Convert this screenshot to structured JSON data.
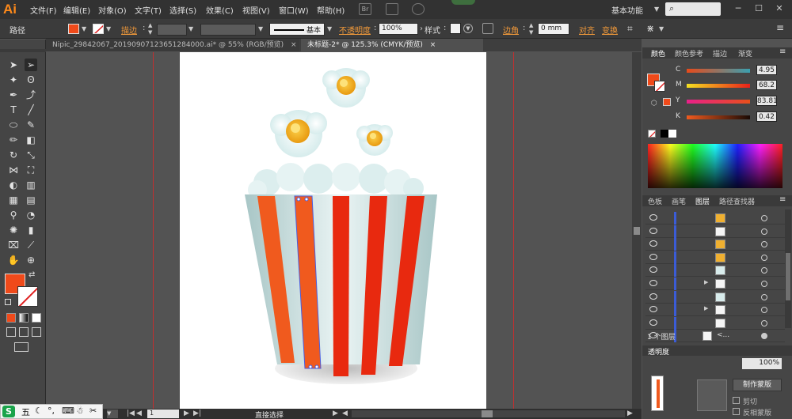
{
  "app": {
    "logo": "Ai"
  },
  "menu": {
    "items": [
      "文件(F)",
      "编辑(E)",
      "对象(O)",
      "文字(T)",
      "选择(S)",
      "效果(C)",
      "视图(V)",
      "窗口(W)",
      "帮助(H)"
    ],
    "workspace": "基本功能",
    "br_label": "Br"
  },
  "control": {
    "selection_type": "路径",
    "stroke_label": "描边",
    "brush_label": "基本",
    "opacity_label": "不透明度",
    "opacity_value": "100%",
    "style_label": "样式",
    "corner_label": "边角",
    "corner_value": "0 mm",
    "align_label": "对齐",
    "transform_label": "变换",
    "fill_color": "#f04a1a"
  },
  "tabs": [
    {
      "label": "Nipic_29842067_20190907123651284000.ai* @ 55% (RGB/预览)",
      "close": "×"
    },
    {
      "label": "未标题-2* @ 125.3% (CMYK/预览)",
      "close": "×"
    }
  ],
  "color_panel": {
    "tabs": [
      "颜色",
      "颜色参考",
      "描边",
      "渐变"
    ],
    "channels": [
      {
        "label": "C",
        "value": "4.95"
      },
      {
        "label": "M",
        "value": "68.2"
      },
      {
        "label": "Y",
        "value": "83.81"
      },
      {
        "label": "K",
        "value": "0.42"
      }
    ],
    "fill_color": "#f04a1a"
  },
  "layers_panel": {
    "tabs": [
      "色板",
      "画笔",
      "图层",
      "路径查找器"
    ],
    "footer": "1 个图层",
    "last_row_label": "<...",
    "rows": [
      {
        "thumb": "#f0b030",
        "expander": ""
      },
      {
        "thumb": "#f5f5f5",
        "expander": ""
      },
      {
        "thumb": "#f0b030",
        "expander": ""
      },
      {
        "thumb": "#f0b030",
        "expander": ""
      },
      {
        "thumb": "#d8ecec",
        "expander": ""
      },
      {
        "thumb": "#f5f5f5",
        "expander": "▶"
      },
      {
        "thumb": "#d8ecec",
        "expander": ""
      },
      {
        "thumb": "#f5f5f5",
        "expander": "▶"
      },
      {
        "thumb": "#f5f5f5",
        "expander": ""
      }
    ]
  },
  "transparency_panel": {
    "tab": "透明度",
    "opacity": "100%",
    "make_mask": "制作蒙版",
    "clip_label": "剪切",
    "invert_label": "反相蒙版"
  },
  "status": {
    "zoom": "125.3%",
    "page": "1",
    "tool": "直接选择"
  },
  "ime": {
    "label": "五"
  },
  "artwork": {
    "stripe_red": "#e8290f",
    "stripe_orange": "#f05a1e",
    "bucket_base": "#c8dcdc",
    "popcorn_yellow": "#f5b818"
  }
}
